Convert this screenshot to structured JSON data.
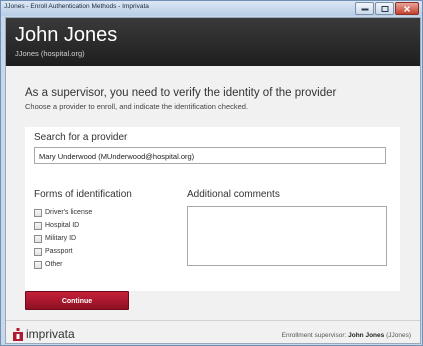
{
  "window": {
    "title": "JJones - Enroll Authentication Methods - Imprivata"
  },
  "header": {
    "user_name": "John Jones",
    "user_id": "JJones (hospital.org)"
  },
  "main": {
    "heading": "As a supervisor, you need to verify the identity of the provider",
    "subheading": "Choose a provider to enroll, and indicate the identification checked."
  },
  "search": {
    "label": "Search for a provider",
    "value": "Mary Underwood (MUnderwood@hospital.org)"
  },
  "identification": {
    "label": "Forms of identification",
    "options": [
      {
        "label": "Driver's license",
        "checked": false
      },
      {
        "label": "Hospital ID",
        "checked": false
      },
      {
        "label": "Military ID",
        "checked": false
      },
      {
        "label": "Passport",
        "checked": false
      },
      {
        "label": "Other",
        "checked": false
      }
    ]
  },
  "comments": {
    "label": "Additional comments",
    "value": ""
  },
  "actions": {
    "continue_label": "Continue"
  },
  "footer": {
    "logo_text": "imprivata",
    "supervisor_prefix": "Enrollment supervisor:",
    "supervisor_name": "John Jones",
    "supervisor_id": "(JJones)"
  },
  "colors": {
    "accent": "#b01a32",
    "header_bg": "#2a2a2a"
  }
}
